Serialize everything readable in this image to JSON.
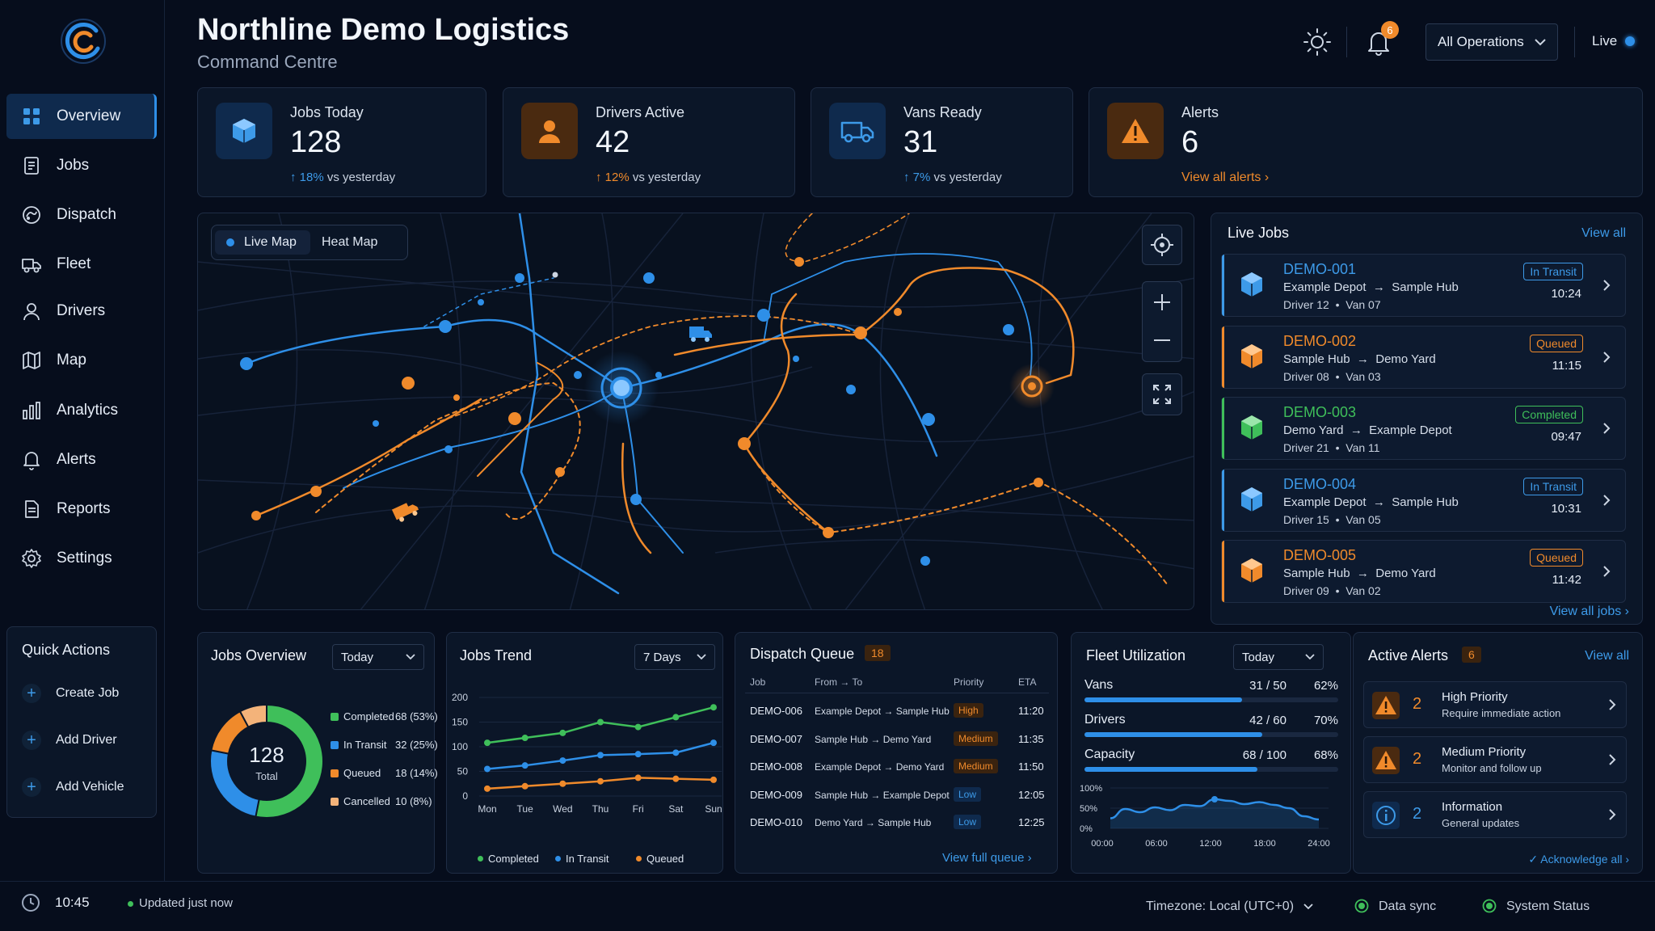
{
  "app": {
    "title": "Northline Demo Logistics",
    "subtitle": "Command Centre"
  },
  "header": {
    "notification_count": "6",
    "operations_select": "All Operations",
    "live_label": "Live"
  },
  "sidebar": {
    "items": [
      {
        "label": "Overview",
        "icon": "grid-icon",
        "active": true
      },
      {
        "label": "Jobs",
        "icon": "document-icon"
      },
      {
        "label": "Dispatch",
        "icon": "dispatch-icon"
      },
      {
        "label": "Fleet",
        "icon": "truck-icon"
      },
      {
        "label": "Drivers",
        "icon": "user-icon"
      },
      {
        "label": "Map",
        "icon": "map-icon"
      },
      {
        "label": "Analytics",
        "icon": "bar-chart-icon"
      },
      {
        "label": "Alerts",
        "icon": "bell-icon"
      },
      {
        "label": "Reports",
        "icon": "report-icon"
      },
      {
        "label": "Settings",
        "icon": "gear-icon"
      }
    ]
  },
  "quick_actions": {
    "title": "Quick Actions",
    "items": [
      "Create Job",
      "Add Driver",
      "Add Vehicle"
    ]
  },
  "stats": [
    {
      "label": "Jobs Today",
      "value": "128",
      "change": "18%",
      "change_suffix": "vs yesterday"
    },
    {
      "label": "Drivers Active",
      "value": "42",
      "change": "12%",
      "change_suffix": "vs yesterday"
    },
    {
      "label": "Vans Ready",
      "value": "31",
      "change": "7%",
      "change_suffix": "vs yesterday"
    },
    {
      "label": "Alerts",
      "value": "6",
      "link": "View all alerts"
    }
  ],
  "map": {
    "tabs": [
      "Live Map",
      "Heat Map"
    ],
    "active_tab": "Live Map"
  },
  "live_jobs": {
    "title": "Live Jobs",
    "view_all": "View all",
    "footer_link": "View all jobs",
    "jobs": [
      {
        "id": "DEMO-001",
        "from": "Example Depot",
        "to": "Sample Hub",
        "driver": "Driver 12",
        "van": "Van 07",
        "status": "In Transit",
        "time": "10:24",
        "color": "#3d9ae8"
      },
      {
        "id": "DEMO-002",
        "from": "Sample Hub",
        "to": "Demo Yard",
        "driver": "Driver 08",
        "van": "Van 03",
        "status": "Queued",
        "time": "11:15",
        "color": "#f08a2b"
      },
      {
        "id": "DEMO-003",
        "from": "Demo Yard",
        "to": "Example Depot",
        "driver": "Driver 21",
        "van": "Van 11",
        "status": "Completed",
        "time": "09:47",
        "color": "#3fbf5a"
      },
      {
        "id": "DEMO-004",
        "from": "Example Depot",
        "to": "Sample Hub",
        "driver": "Driver 15",
        "van": "Van 05",
        "status": "In Transit",
        "time": "10:31",
        "color": "#3d9ae8"
      },
      {
        "id": "DEMO-005",
        "from": "Sample Hub",
        "to": "Demo Yard",
        "driver": "Driver 09",
        "van": "Van 02",
        "status": "Queued",
        "time": "11:42",
        "color": "#f08a2b"
      }
    ]
  },
  "jobs_overview": {
    "title": "Jobs Overview",
    "range": "Today",
    "total": "128",
    "total_label": "Total",
    "chart_data": {
      "type": "pie",
      "categories": [
        "Completed",
        "In Transit",
        "Queued",
        "Cancelled"
      ],
      "values": [
        68,
        32,
        18,
        10
      ],
      "labels": [
        "68 (53%)",
        "32 (25%)",
        "18 (14%)",
        "10 (8%)"
      ],
      "colors": [
        "#3fbf5a",
        "#2e8fe8",
        "#f08a2b",
        "#f3b37a"
      ]
    }
  },
  "jobs_trend": {
    "title": "Jobs Trend",
    "range": "7 Days",
    "chart_data": {
      "type": "line",
      "categories": [
        "Mon",
        "Tue",
        "Wed",
        "Thu",
        "Fri",
        "Sat",
        "Sun"
      ],
      "ylim": [
        0,
        200
      ],
      "yticks": [
        0,
        50,
        100,
        150,
        200
      ],
      "series": [
        {
          "name": "Completed",
          "color": "#3fbf5a",
          "values": [
            108,
            118,
            128,
            150,
            140,
            160,
            180
          ]
        },
        {
          "name": "In Transit",
          "color": "#2e8fe8",
          "values": [
            55,
            62,
            72,
            83,
            85,
            88,
            108
          ]
        },
        {
          "name": "Queued",
          "color": "#f08a2b",
          "values": [
            15,
            20,
            25,
            30,
            37,
            35,
            33
          ]
        }
      ]
    }
  },
  "dispatch_queue": {
    "title": "Dispatch Queue",
    "count": "18",
    "headers": [
      "Job",
      "From → To",
      "Priority",
      "ETA"
    ],
    "footer_link": "View full queue",
    "rows": [
      {
        "job": "DEMO-006",
        "route": "Example Depot → Sample Hub",
        "priority": "High",
        "eta": "11:20"
      },
      {
        "job": "DEMO-007",
        "route": "Sample Hub → Demo Yard",
        "priority": "Medium",
        "eta": "11:35"
      },
      {
        "job": "DEMO-008",
        "route": "Example Depot → Demo Yard",
        "priority": "Medium",
        "eta": "11:50"
      },
      {
        "job": "DEMO-009",
        "route": "Sample Hub → Example Depot",
        "priority": "Low",
        "eta": "12:05"
      },
      {
        "job": "DEMO-010",
        "route": "Demo Yard → Sample Hub",
        "priority": "Low",
        "eta": "12:25"
      }
    ]
  },
  "fleet": {
    "title": "Fleet Utilization",
    "range": "Today",
    "rows": [
      {
        "label": "Vans",
        "value": "31 / 50",
        "percent": "62%",
        "fraction": 0.62
      },
      {
        "label": "Drivers",
        "value": "42 / 60",
        "percent": "70%",
        "fraction": 0.7
      },
      {
        "label": "Capacity",
        "value": "68 / 100",
        "percent": "68%",
        "fraction": 0.68
      }
    ],
    "chart_data": {
      "type": "area",
      "x": [
        "00:00",
        "06:00",
        "12:00",
        "18:00",
        "24:00"
      ],
      "yticks": [
        "100%",
        "50%",
        "0%"
      ],
      "ylim": [
        0,
        100
      ],
      "series": [
        {
          "values": [
            25,
            48,
            40,
            52,
            45,
            58,
            55,
            72,
            68,
            60,
            65,
            58,
            50,
            30,
            22
          ]
        }
      ]
    }
  },
  "active_alerts": {
    "title": "Active Alerts",
    "count": "6",
    "view_all": "View all",
    "footer_link": "Acknowledge all",
    "items": [
      {
        "count": "2",
        "title": "High Priority",
        "subtitle": "Require immediate action",
        "kind": "warning-icon"
      },
      {
        "count": "2",
        "title": "Medium Priority",
        "subtitle": "Monitor and follow up",
        "kind": "warning-icon"
      },
      {
        "count": "2",
        "title": "Information",
        "subtitle": "General updates",
        "kind": "info-icon"
      }
    ]
  },
  "footer": {
    "time": "10:45",
    "updated": "Updated just now",
    "timezone": "Timezone: Local (UTC+0)",
    "data_sync": "Data sync",
    "system_status": "System Status"
  }
}
